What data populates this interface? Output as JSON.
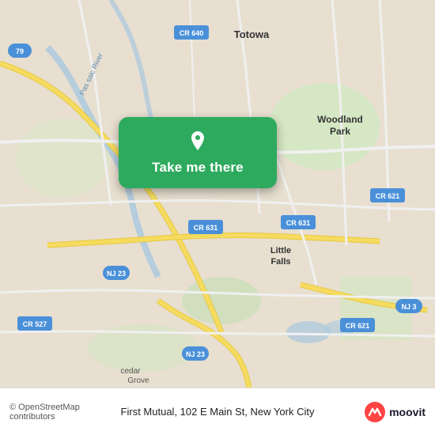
{
  "map": {
    "center_lat": 40.878,
    "center_lng": -74.19,
    "bg_color": "#e8dfd0",
    "water_color": "#b3d4e8",
    "green_color": "#d5e8c8",
    "road_color": "#ffffff",
    "road_yellow": "#f5e6a0",
    "alt_road": "#f0d080"
  },
  "overlay": {
    "button_label": "Take me there",
    "button_bg": "#2eaa5e",
    "pin_color": "#ffffff"
  },
  "bottom": {
    "copyright": "© OpenStreetMap contributors",
    "address": "First Mutual, 102 E Main St, New York City",
    "logo_text": "moovit"
  },
  "labels": {
    "totowa": "Totowa",
    "woodland_park": "Woodland Park",
    "little_falls": "Little\nFalls",
    "cr640": "CR 640",
    "cr631": "CR 631",
    "cr631_r": "CR 631",
    "cr621": "CR 621",
    "cr621_b": "CR 621",
    "cr527": "CR 527",
    "nj23": "NJ 23",
    "nj23_b": "NJ 23",
    "nj3": "NJ 3",
    "pas_saic": "Pas saic River",
    "cedar": "cedar",
    "grove": "Grove"
  }
}
